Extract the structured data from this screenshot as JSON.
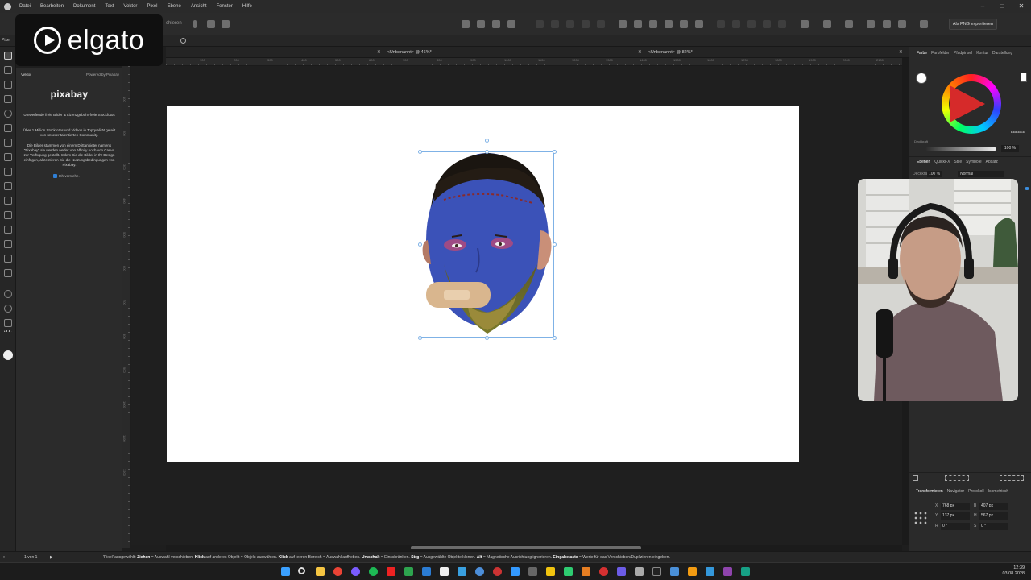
{
  "menubar": {
    "items": [
      "Datei",
      "Bearbeiten",
      "Dokument",
      "Text",
      "Vektor",
      "Pixel",
      "Ebene",
      "Ansicht",
      "Fenster",
      "Hilfe"
    ]
  },
  "toolbar": {
    "export_label": "Als PNG exportieren",
    "partial_label": "chieren"
  },
  "tabs": [
    {
      "label": "<Unbenannt> @ 46%*"
    },
    {
      "label": "<Unbenannt> @ 82%*"
    }
  ],
  "left_panel": {
    "label": "Pixel",
    "vector_label": "Vektor",
    "powered_by": "Powered by Pixabay",
    "logo": "pixabay",
    "tagline": "Umwerfende freie Bilder & Lizenzgebühr-freie Stockfotos",
    "intro": "Über 1 Million Stockfotos und Videos in Topqualität geteilt von unserer talentierten Community.",
    "terms": "Die Bilder stammen von einem Drittanbieter namens \"Pixabay\" sie werden weder von Affinity noch von Canva zur Verfügung gestellt. Indem Sie die Bilder in Ihr Design einfügen, akzeptieren Sie die Nutzungsbedingungen von Pixabay.",
    "checkbox_label": "Ich verstehe."
  },
  "overlay": {
    "brand": "elgato"
  },
  "right_panel": {
    "top_tabs": [
      "Farbe",
      "Farbfelder",
      "Pfadpinsel",
      "Kontur",
      "Darstellung"
    ],
    "hex": "EBEBEB",
    "opacity_label": "Deckkraft",
    "opacity_value": "100 %",
    "layer_tabs": [
      "Ebenen",
      "QuickFX",
      "Stile",
      "Symbole",
      "Absatz"
    ],
    "layer_opacity_label": "Deckkraft",
    "layer_opacity": "100 %",
    "blend_mode": "Normal",
    "bottom_tabs": [
      "Transformieren",
      "Navigator",
      "Protokoll",
      "Isometrisch"
    ],
    "transform": {
      "x": "768 px",
      "y": "137 px",
      "w": "407 px",
      "h": "567 px",
      "r": "0 °",
      "s": "0 °"
    }
  },
  "status": {
    "page": "1 von 1",
    "message_parts": [
      {
        "t": "'Pixel' ausgewählt: ",
        "b": false
      },
      {
        "t": "Ziehen",
        "b": true
      },
      {
        "t": " = Auswahl verschieben. ",
        "b": false
      },
      {
        "t": "Klick",
        "b": true
      },
      {
        "t": " auf anderes Objekt = Objekt auswählen. ",
        "b": false
      },
      {
        "t": "Klick",
        "b": true
      },
      {
        "t": " auf leeren Bereich = Auswahl aufheben. ",
        "b": false
      },
      {
        "t": "Umschalt",
        "b": true
      },
      {
        "t": " = Einschränken. ",
        "b": false
      },
      {
        "t": "Strg",
        "b": true
      },
      {
        "t": " = Ausgewählte Objekte klonen. ",
        "b": false
      },
      {
        "t": "Alt",
        "b": true
      },
      {
        "t": " = Magnetische Ausrichtung ignorieren. ",
        "b": false
      },
      {
        "t": "Eingabetaste",
        "b": true
      },
      {
        "t": " = Werte für das Verschieben/Duplizieren eingeben.",
        "b": false
      }
    ]
  },
  "taskbar": {
    "time": "12:39",
    "date": "03.08.2028"
  },
  "ruler": {
    "h_ticks": [
      "100",
      "200",
      "300",
      "400",
      "500",
      "600",
      "700",
      "800",
      "900",
      "1000",
      "1100",
      "1200",
      "1300",
      "1400",
      "1500",
      "1600",
      "1700",
      "1800",
      "1900",
      "2000",
      "2100"
    ],
    "v_ticks": [
      "100",
      "200",
      "300",
      "400",
      "500",
      "600",
      "700",
      "800",
      "900",
      "1000",
      "1100",
      "1200"
    ]
  },
  "colors": {
    "accent": "#2f7fd6",
    "selection": "#7fb2e6",
    "artboard": "#ffffff"
  }
}
